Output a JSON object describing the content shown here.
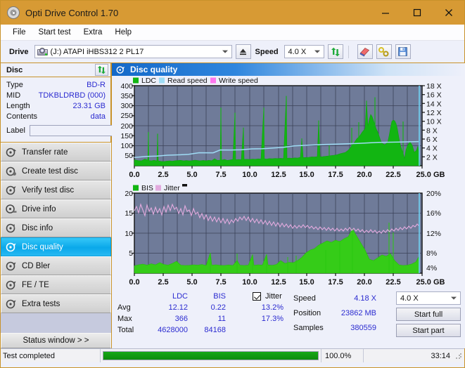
{
  "window": {
    "title": "Opti Drive Control 1.70",
    "icon": "disc-icon",
    "minimize": "minimize-icon",
    "maximize": "maximize-icon",
    "close": "close-icon"
  },
  "menu": [
    "File",
    "Start test",
    "Extra",
    "Help"
  ],
  "toolbar": {
    "drive_label": "Drive",
    "drive_value": "(J:)  ATAPI iHBS312  2 PL17",
    "eject_icon": "eject-icon",
    "speed_label": "Speed",
    "speed_value": "4.0 X",
    "refresh_icon": "refresh-icon",
    "erase_icon": "eraser-icon",
    "tools_icon": "wrench-icon",
    "save_icon": "floppy-save-icon"
  },
  "disc_panel": {
    "title": "Disc",
    "refresh_icon": "refresh-icon",
    "rows": [
      {
        "key": "Type",
        "value": "BD-R"
      },
      {
        "key": "MID",
        "value": "TDKBLDRBD (000)"
      },
      {
        "key": "Length",
        "value": "23.31 GB"
      },
      {
        "key": "Contents",
        "value": "data"
      }
    ],
    "label_key": "Label",
    "label_value": "",
    "label_placeholder": "",
    "label_button_icon": "disc-icon"
  },
  "sidebar": {
    "items": [
      {
        "label": "Transfer rate",
        "icon": "disc-transfer-icon",
        "active": false
      },
      {
        "label": "Create test disc",
        "icon": "disc-create-icon",
        "active": false
      },
      {
        "label": "Verify test disc",
        "icon": "disc-verify-icon",
        "active": false
      },
      {
        "label": "Drive info",
        "icon": "drive-info-icon",
        "active": false
      },
      {
        "label": "Disc info",
        "icon": "disc-info-icon",
        "active": false
      },
      {
        "label": "Disc quality",
        "icon": "disc-quality-icon",
        "active": true
      },
      {
        "label": "CD Bler",
        "icon": "disc-bler-icon",
        "active": false
      },
      {
        "label": "FE / TE",
        "icon": "disc-fete-icon",
        "active": false
      },
      {
        "label": "Extra tests",
        "icon": "disc-extra-icon",
        "active": false
      }
    ],
    "status_window_button": "Status window > >"
  },
  "main": {
    "header_title": "Disc quality",
    "header_icon": "disc-quality-icon"
  },
  "stats": {
    "col_headers": [
      "LDC",
      "BIS"
    ],
    "jitter_label": "Jitter",
    "jitter_checked": true,
    "rows": [
      {
        "key": "Avg",
        "ldc": "12.12",
        "bis": "0.22",
        "jitter": "13.2%"
      },
      {
        "key": "Max",
        "ldc": "366",
        "bis": "11",
        "jitter": "17.3%"
      },
      {
        "key": "Total",
        "ldc": "4628000",
        "bis": "84168",
        "jitter": ""
      }
    ],
    "right": [
      {
        "key": "Speed",
        "value": "4.18 X"
      },
      {
        "key": "Position",
        "value": "23862 MB"
      },
      {
        "key": "Samples",
        "value": "380559"
      }
    ],
    "speed_select": "4.0 X",
    "start_full": "Start full",
    "start_part": "Start part"
  },
  "statusbar": {
    "message": "Test completed",
    "progress_pct_text": "100.0%",
    "progress_pct": 100,
    "elapsed": "33:14"
  },
  "colors": {
    "titlebar": "#d79a34",
    "ldc_green": "#12b512",
    "read_speed": "#9fdcf5",
    "write_speed": "#ff77ee",
    "bis_green": "#12b512",
    "jitter_pink": "#e2aade",
    "plot_bg": "#6f7b99",
    "accent_blue": "#2b2bd0",
    "progress_green": "#11a011"
  },
  "chart_data": [
    {
      "type": "area",
      "name": "disc-quality-ldc",
      "title": "",
      "xlabel": "GB",
      "ylabel": "",
      "xlim": [
        0.0,
        25.0
      ],
      "ylim": [
        0,
        400
      ],
      "y2lim": [
        0,
        18
      ],
      "y2label": "X",
      "xticks": [
        0.0,
        2.5,
        5.0,
        7.5,
        10.0,
        12.5,
        15.0,
        17.5,
        20.0,
        22.5,
        25.0
      ],
      "xticklabels": [
        "0.0",
        "2.5",
        "5.0",
        "7.5",
        "10.0",
        "12.5",
        "15.0",
        "17.5",
        "20.0",
        "22.5",
        "25.0 GB"
      ],
      "yticks": [
        50,
        100,
        150,
        200,
        250,
        300,
        350,
        400
      ],
      "yticklabels": [
        "50",
        "100",
        "150",
        "200",
        "250",
        "300",
        "350",
        "400"
      ],
      "y2ticks": [
        2,
        4,
        6,
        8,
        10,
        12,
        14,
        16,
        18
      ],
      "y2ticklabels": [
        "2 X",
        "4 X",
        "6 X",
        "8 X",
        "10 X",
        "12 X",
        "14 X",
        "16 X",
        "18 X"
      ],
      "grid": true,
      "legend": [
        "LDC",
        "Read speed",
        "Write speed"
      ],
      "legend_position": "top-left",
      "series": [
        {
          "name": "LDC",
          "color": "#12b512",
          "kind": "area-spikes",
          "x": [
            0.0,
            0.3,
            0.6,
            0.9,
            1.2,
            1.5,
            1.8,
            2.1,
            2.4,
            2.7,
            3.0,
            3.3,
            3.6,
            3.9,
            4.2,
            4.5,
            4.8,
            5.1,
            5.4,
            5.7,
            6.0,
            6.3,
            6.6,
            6.9,
            7.2,
            7.5,
            7.8,
            8.1,
            8.4,
            8.7,
            9.0,
            9.3,
            9.6,
            9.9,
            10.2,
            10.5,
            10.8,
            11.1,
            11.4,
            11.7,
            12.0,
            12.3,
            12.6,
            12.9,
            13.2,
            13.5,
            13.8,
            14.1,
            14.4,
            14.7,
            15.0,
            15.3,
            15.6,
            15.9,
            16.2,
            16.5,
            16.8,
            17.1,
            17.4,
            17.7,
            18.0,
            18.3,
            18.6,
            18.9,
            19.2,
            19.5,
            19.8,
            20.1,
            20.4,
            20.7,
            21.0,
            21.3,
            21.6,
            21.9,
            22.2,
            22.5,
            22.8,
            23.1,
            23.4
          ],
          "y": [
            30,
            28,
            26,
            35,
            168,
            30,
            160,
            28,
            26,
            25,
            24,
            24,
            26,
            26,
            28,
            26,
            30,
            24,
            28,
            30,
            95,
            32,
            36,
            32,
            40,
            290,
            46,
            42,
            52,
            265,
            60,
            190,
            52,
            48,
            50,
            46,
            48,
            54,
            290,
            52,
            50,
            58,
            60,
            62,
            366,
            60,
            64,
            66,
            70,
            66,
            136,
            76,
            78,
            80,
            226,
            84,
            80,
            86,
            120,
            100,
            120,
            150,
            170,
            196,
            206,
            325,
            250,
            240,
            222,
            200,
            186,
            160,
            150,
            220,
            170,
            120,
            62,
            90,
            100
          ],
          "peaks": [
            {
              "x": 1.2,
              "y": 168
            },
            {
              "x": 1.8,
              "y": 160
            },
            {
              "x": 7.5,
              "y": 290
            },
            {
              "x": 8.7,
              "y": 265
            },
            {
              "x": 9.3,
              "y": 190
            },
            {
              "x": 11.4,
              "y": 290
            },
            {
              "x": 13.2,
              "y": 366
            },
            {
              "x": 16.2,
              "y": 226
            },
            {
              "x": 19.5,
              "y": 325
            },
            {
              "x": 21.9,
              "y": 220
            }
          ]
        },
        {
          "name": "Read speed",
          "color": "#9fdcf5",
          "kind": "step-line",
          "x": [
            0.0,
            1.0,
            2.0,
            3.0,
            4.0,
            5.0,
            6.0,
            7.0,
            8.0,
            9.0,
            10.0,
            11.0,
            12.0,
            13.0,
            14.0,
            15.0,
            16.0,
            17.0,
            18.0,
            19.0,
            20.0,
            21.0,
            22.0,
            23.0,
            23.4,
            23.4
          ],
          "y": [
            1.9,
            2.1,
            2.2,
            2.4,
            2.5,
            2.6,
            2.9,
            2.9,
            3.0,
            3.0,
            3.1,
            3.2,
            3.2,
            3.4,
            3.6,
            3.7,
            3.8,
            3.9,
            3.9,
            4.0,
            4.0,
            4.1,
            4.1,
            4.2,
            4.2,
            18.0
          ]
        },
        {
          "name": "Write speed",
          "color": "#ff77ee",
          "kind": "line",
          "x": [],
          "y": []
        }
      ]
    },
    {
      "type": "area",
      "name": "disc-quality-bis-jitter",
      "title": "",
      "xlabel": "GB",
      "ylabel": "",
      "xlim": [
        0.0,
        25.0
      ],
      "ylim": [
        0,
        20
      ],
      "y2lim": [
        0,
        20
      ],
      "y2label": "%",
      "xticks": [
        0.0,
        2.5,
        5.0,
        7.5,
        10.0,
        12.5,
        15.0,
        17.5,
        20.0,
        22.5,
        25.0
      ],
      "xticklabels": [
        "0.0",
        "2.5",
        "5.0",
        "7.5",
        "10.0",
        "12.5",
        "15.0",
        "17.5",
        "20.0",
        "22.5",
        "25.0 GB"
      ],
      "yticks": [
        5,
        10,
        15,
        20
      ],
      "yticklabels": [
        "5",
        "10",
        "15",
        "20"
      ],
      "y2ticks": [
        4,
        8,
        12,
        16,
        20
      ],
      "y2ticklabels": [
        "4%",
        "8%",
        "12%",
        "16%",
        "20%"
      ],
      "grid": true,
      "legend": [
        "BIS",
        "Jitter"
      ],
      "legend_position": "top-left",
      "series": [
        {
          "name": "BIS",
          "color": "#12b512",
          "kind": "area-spikes",
          "x": [
            0.0,
            0.5,
            1.0,
            1.5,
            2.0,
            2.5,
            3.0,
            3.5,
            4.0,
            4.5,
            5.0,
            5.5,
            6.0,
            6.5,
            7.0,
            7.5,
            8.0,
            8.5,
            9.0,
            9.5,
            10.0,
            10.5,
            11.0,
            11.5,
            12.0,
            12.5,
            13.0,
            13.5,
            14.0,
            14.5,
            15.0,
            15.5,
            16.0,
            16.5,
            17.0,
            17.5,
            18.0,
            18.5,
            19.0,
            19.5,
            20.0,
            20.5,
            21.0,
            21.5,
            22.0,
            22.5,
            23.0,
            23.4
          ],
          "y": [
            1.8,
            2.2,
            2.4,
            2.3,
            2.6,
            3.0,
            2.7,
            2.5,
            2.3,
            2.6,
            3.2,
            2.0,
            2.1,
            2.0,
            2.2,
            2.1,
            2.3,
            4.8,
            2.6,
            2.4,
            2.2,
            2.1,
            2.3,
            2.0,
            3.3,
            2.2,
            2.1,
            4.5,
            2.2,
            2.3,
            4.6,
            2.2,
            4.3,
            2.6,
            3.0,
            3.3,
            5.6,
            6.5,
            7.8,
            8.6,
            8.2,
            8.0,
            8.4,
            9.4,
            11.0,
            5.4,
            4.0,
            4.4
          ]
        },
        {
          "name": "Jitter",
          "color": "#e2aade",
          "kind": "noisy-line",
          "x": [
            0.0,
            0.5,
            1.0,
            1.5,
            2.0,
            2.5,
            3.0,
            3.5,
            4.0,
            4.5,
            5.0,
            5.5,
            6.0,
            6.5,
            7.0,
            7.5,
            8.0,
            8.5,
            9.0,
            9.5,
            10.0,
            10.5,
            11.0,
            11.5,
            12.0,
            12.5,
            13.0,
            13.5,
            14.0,
            14.5,
            15.0,
            15.5,
            16.0,
            16.5,
            17.0,
            17.5,
            18.0,
            18.5,
            19.0,
            19.5,
            20.0,
            20.5,
            21.0,
            21.5,
            22.0,
            22.5,
            23.0
          ],
          "y": [
            15.6,
            16.3,
            14.8,
            15.2,
            15.4,
            15.6,
            15.3,
            16.0,
            16.2,
            15.8,
            15.3,
            14.4,
            14.0,
            13.9,
            13.8,
            13.7,
            13.9,
            14.0,
            14.2,
            14.0,
            14.2,
            13.6,
            13.4,
            13.2,
            13.0,
            12.8,
            12.7,
            12.5,
            12.4,
            12.5,
            12.3,
            12.4,
            12.3,
            12.5,
            12.4,
            12.3,
            12.2,
            12.1,
            12.0,
            11.9,
            12.0,
            12.1,
            12.2,
            12.3,
            12.4,
            12.6,
            12.8
          ]
        },
        {
          "name": "Read speed cursor",
          "color": "#9fdcf5",
          "kind": "vline",
          "x": [
            23.4
          ],
          "y": [
            20
          ]
        }
      ]
    }
  ]
}
